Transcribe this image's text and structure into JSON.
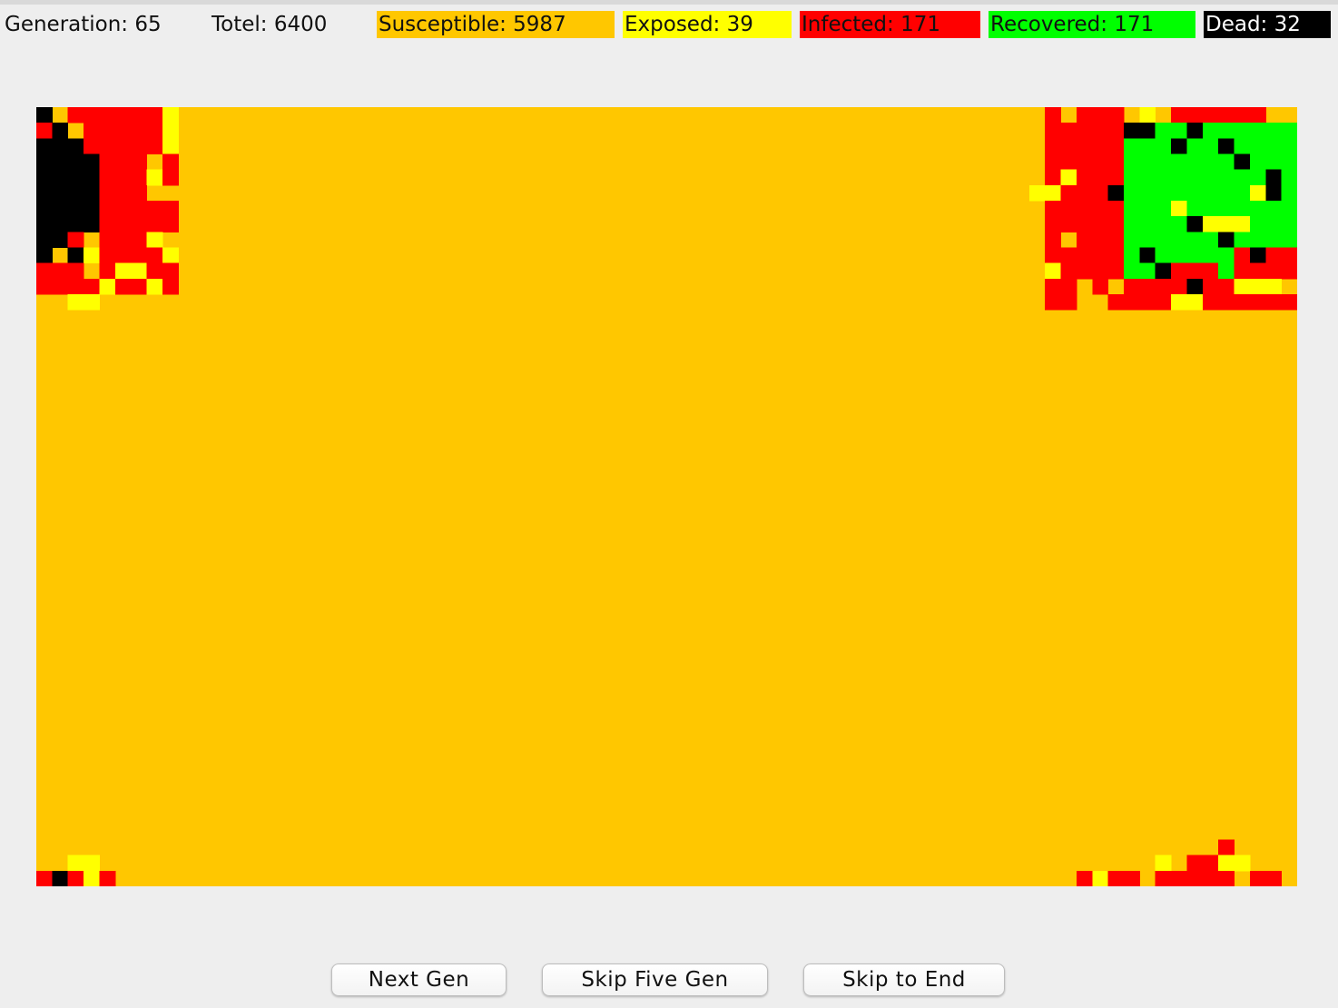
{
  "stats": {
    "generation": "Generation: 65",
    "total": "Totel: 6400",
    "susceptible": "Susceptible: 5987",
    "exposed": "Exposed: 39",
    "infected": "Infected: 171",
    "recovered": "Recovered: 171",
    "dead": "Dead: 32"
  },
  "colors": {
    "susceptible": "#ffc700",
    "exposed": "#ffff00",
    "infected": "#ff0000",
    "recovered": "#00ff00",
    "dead": "#000000"
  },
  "buttons": {
    "next_gen": "Next Gen",
    "skip_five": "Skip Five Gen",
    "skip_end": "Skip to End"
  }
}
